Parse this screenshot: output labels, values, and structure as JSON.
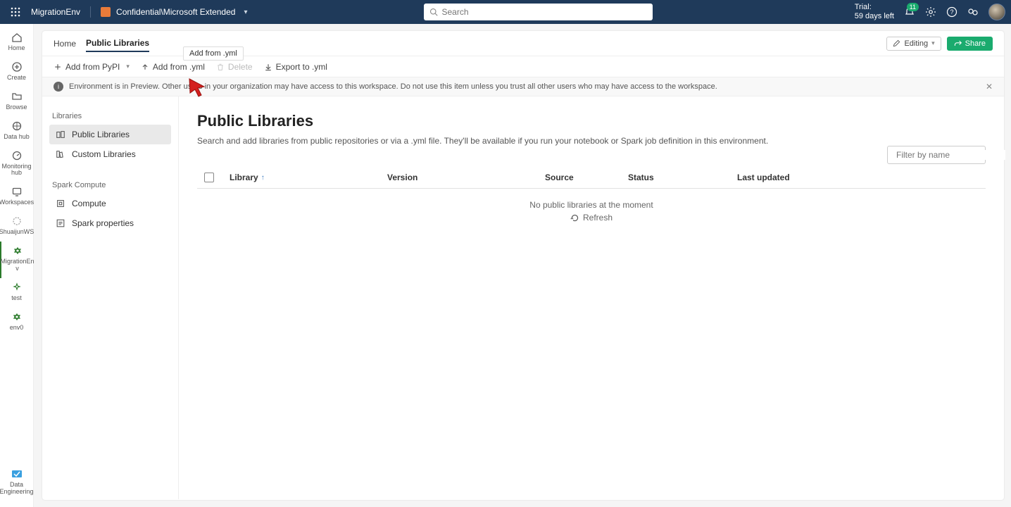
{
  "header": {
    "env_name": "MigrationEnv",
    "org_path": "Confidential\\Microsoft Extended",
    "search_placeholder": "Search",
    "trial_label": "Trial:",
    "trial_days": "59 days left",
    "notif_count": "11"
  },
  "rail": {
    "home": "Home",
    "create": "Create",
    "browse": "Browse",
    "data_hub": "Data hub",
    "monitoring": "Monitoring hub",
    "workspaces": "Workspaces",
    "shuaijun": "ShuaijunWS",
    "migrationen": "MigrationEn v",
    "test": "test",
    "env0": "env0",
    "persona": "Data Engineering"
  },
  "tabs": {
    "home": "Home",
    "public_libraries": "Public Libraries",
    "tooltip": "Add from .yml",
    "editing": "Editing",
    "share": "Share"
  },
  "toolbar": {
    "add_pypi": "Add from PyPI",
    "add_yml": "Add from .yml",
    "delete": "Delete",
    "export_yml": "Export to .yml"
  },
  "banner": {
    "text": "Environment is in Preview. Other users in your organization may have access to this workspace. Do not use this item unless you trust all other users who may have access to the workspace."
  },
  "sidepanel": {
    "libraries_title": "Libraries",
    "public": "Public Libraries",
    "custom": "Custom Libraries",
    "spark_title": "Spark Compute",
    "compute": "Compute",
    "spark_props": "Spark properties"
  },
  "page": {
    "title": "Public Libraries",
    "desc": "Search and add libraries from public repositories or via a .yml file. They'll be available if you run your notebook or Spark job definition in this environment.",
    "filter_placeholder": "Filter by name"
  },
  "table": {
    "library": "Library",
    "version": "Version",
    "source": "Source",
    "status": "Status",
    "last_updated": "Last updated",
    "empty": "No public libraries at the moment",
    "refresh": "Refresh"
  }
}
